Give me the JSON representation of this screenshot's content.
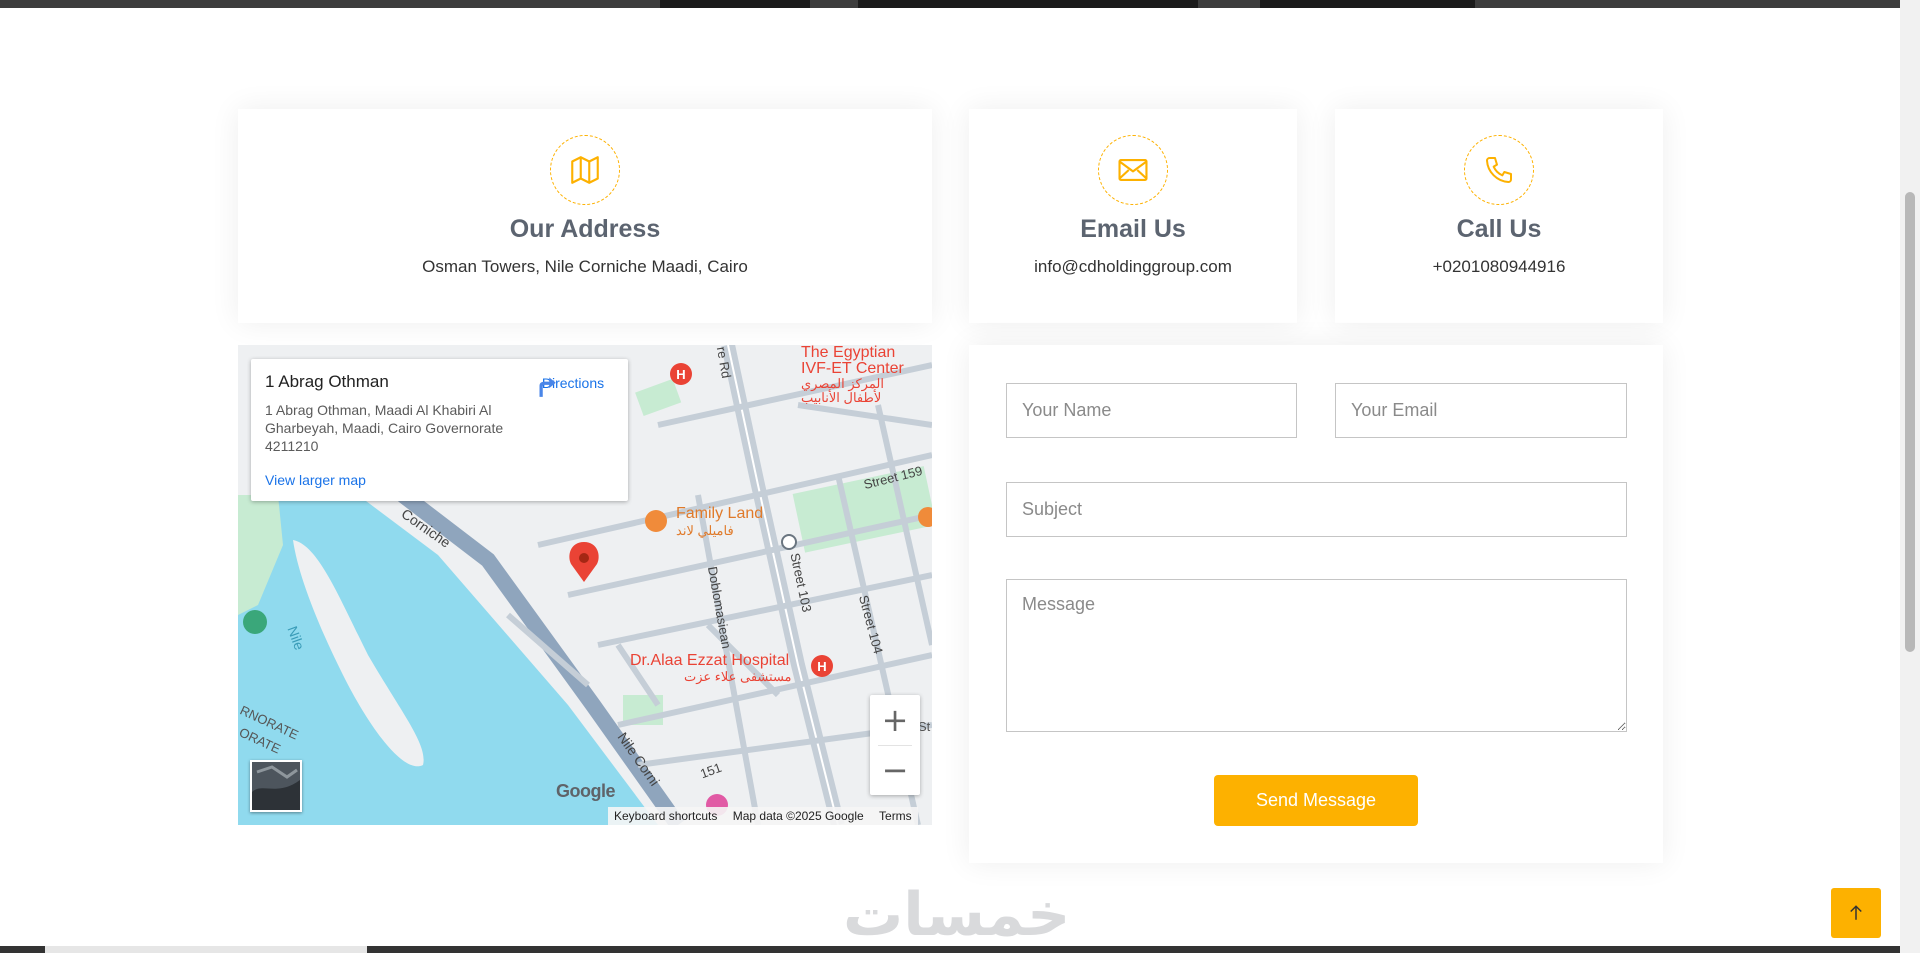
{
  "contact_cards": {
    "address": {
      "icon": "map-icon",
      "title": "Our Address",
      "text": "Osman Towers, Nile Corniche Maadi, Cairo"
    },
    "email": {
      "icon": "envelope-icon",
      "title": "Email Us",
      "text": "info@cdholdinggroup.com"
    },
    "phone": {
      "icon": "phone-icon",
      "title": "Call Us",
      "text": "+0201080944916"
    }
  },
  "map": {
    "place_name": "1 Abrag Othman",
    "place_address": "1 Abrag Othman, Maadi Al Khabiri Al Gharbeyah, Maadi, Cairo Governorate 4211210",
    "directions_label": "Directions",
    "view_larger_label": "View larger map",
    "labels": {
      "ivf_en_1": "The Egyptian",
      "ivf_en_2": "IVF-ET Center",
      "ivf_ar_1": "المركز المصري",
      "ivf_ar_2": "لأطفال الأنابيب",
      "family_en": "Family Land",
      "family_ar": "فاميلي لاند",
      "hospital_en": "Dr.Alaa Ezzat Hospital",
      "hospital_ar": "مستشفى علاء عزت",
      "rd": "re Rd",
      "street159": "Street 159",
      "corniche": "Corniche",
      "nile": "Nile",
      "doblomasiean": "Doblomasiean",
      "street103": "Street 103",
      "street104": "Street 104",
      "nile_corniche": "Nile Corni",
      "road151": "151",
      "governorate_1": "RNORATE",
      "governorate_2": "ORATE",
      "st_letter": "St"
    },
    "google_logo": "Google",
    "keyboard_shortcuts": "Keyboard shortcuts",
    "map_data": "Map data ©2025 Google",
    "terms": "Terms",
    "zoom_in": "+",
    "zoom_out": "−"
  },
  "form": {
    "name_placeholder": "Your Name",
    "email_placeholder": "Your Email",
    "subject_placeholder": "Subject",
    "message_placeholder": "Message",
    "send_label": "Send Message"
  },
  "watermark": "خمسات",
  "colors": {
    "accent": "#fdb100",
    "heading": "#5c6470",
    "link": "#1a73e8",
    "water": "#90daee"
  }
}
